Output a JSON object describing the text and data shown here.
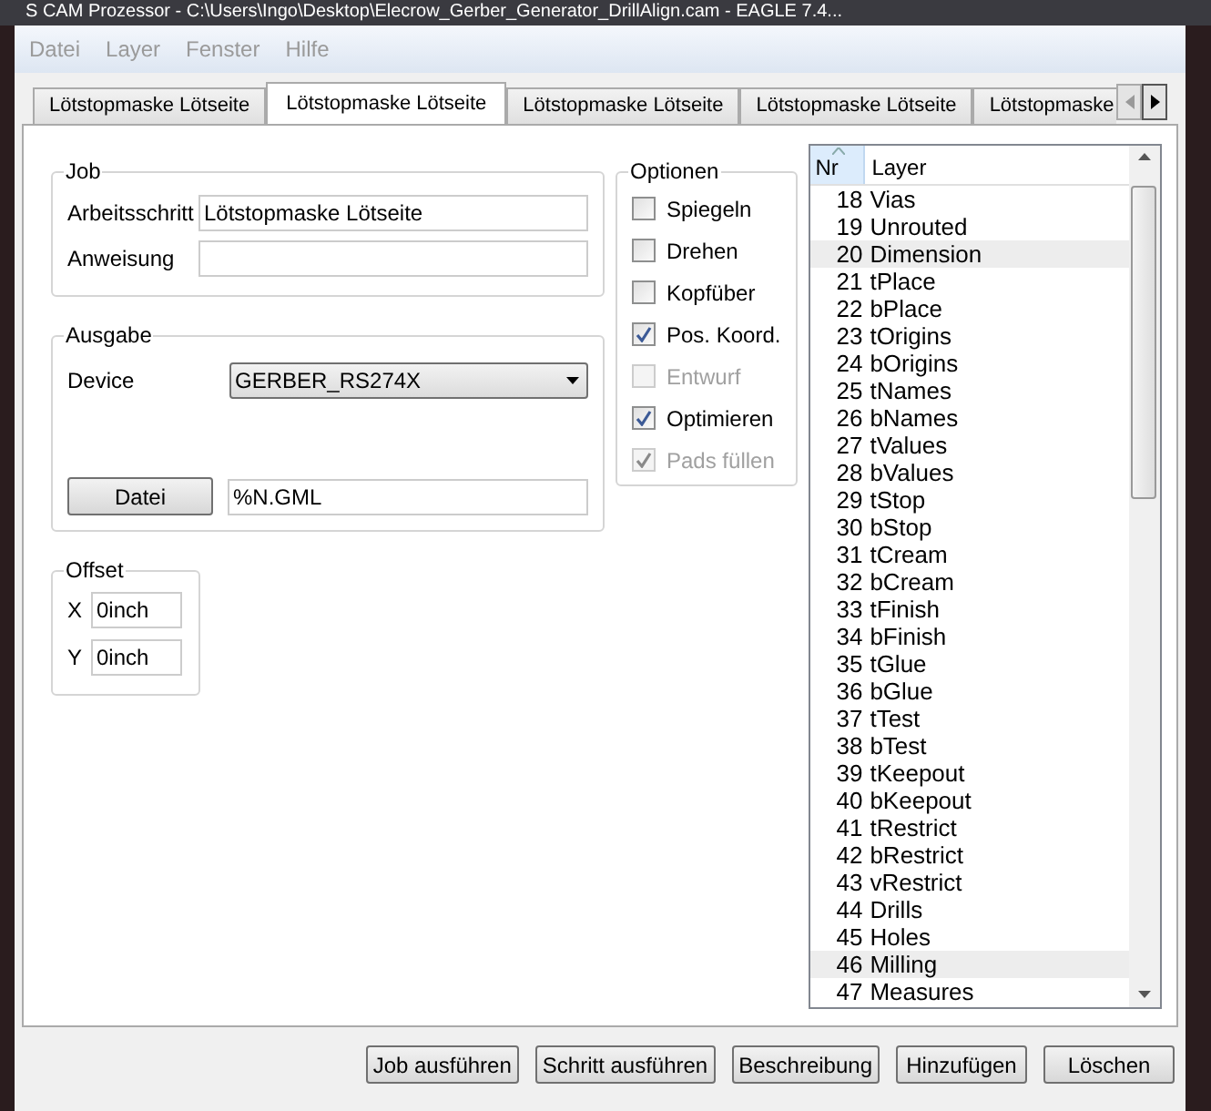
{
  "window": {
    "title": "S CAM Prozessor - C:\\Users\\Ingo\\Desktop\\Elecrow_Gerber_Generator_DrillAlign.cam - EAGLE 7.4..."
  },
  "menu": [
    {
      "label": "Datei",
      "disabled": true
    },
    {
      "label": "Layer",
      "disabled": true
    },
    {
      "label": "Fenster",
      "disabled": true
    },
    {
      "label": "Hilfe",
      "disabled": true
    }
  ],
  "tabs": [
    {
      "label": "Lötstopmaske Lötseite",
      "selected": false
    },
    {
      "label": "Lötstopmaske Lötseite",
      "selected": true
    },
    {
      "label": "Lötstopmaske Lötseite",
      "selected": false
    },
    {
      "label": "Lötstopmaske Lötseite",
      "selected": false
    },
    {
      "label": "Lötstopmaske",
      "selected": false
    }
  ],
  "job": {
    "title": "Job",
    "arbeitsschritt_label": "Arbeitsschritt",
    "arbeitsschritt_value": "Lötstopmaske Lötseite",
    "anweisung_label": "Anweisung"
  },
  "ausgabe": {
    "title": "Ausgabe",
    "device_label": "Device",
    "device_value": "GERBER_RS274X",
    "datei_button": "Datei",
    "datei_value": "%N.GML"
  },
  "offset": {
    "title": "Offset",
    "x_label": "X",
    "x_value": "0inch",
    "y_label": "Y",
    "y_value": "0inch"
  },
  "optionen": {
    "title": "Optionen",
    "items": [
      {
        "label": "Spiegeln",
        "checked": false,
        "disabled": false
      },
      {
        "label": "Drehen",
        "checked": false,
        "disabled": false
      },
      {
        "label": "Kopfüber",
        "checked": false,
        "disabled": false
      },
      {
        "label": "Pos. Koord.",
        "checked": true,
        "disabled": false
      },
      {
        "label": "Entwurf",
        "checked": false,
        "disabled": true
      },
      {
        "label": "Optimieren",
        "checked": true,
        "disabled": false
      },
      {
        "label": "Pads füllen",
        "checked": true,
        "disabled": true
      }
    ]
  },
  "layers": {
    "columns": [
      "Nr",
      "Layer"
    ],
    "rows": [
      {
        "nr": "18",
        "name": "Vias",
        "selected": false
      },
      {
        "nr": "19",
        "name": "Unrouted",
        "selected": false
      },
      {
        "nr": "20",
        "name": "Dimension",
        "selected": true
      },
      {
        "nr": "21",
        "name": "tPlace",
        "selected": false
      },
      {
        "nr": "22",
        "name": "bPlace",
        "selected": false
      },
      {
        "nr": "23",
        "name": "tOrigins",
        "selected": false
      },
      {
        "nr": "24",
        "name": "bOrigins",
        "selected": false
      },
      {
        "nr": "25",
        "name": "tNames",
        "selected": false
      },
      {
        "nr": "26",
        "name": "bNames",
        "selected": false
      },
      {
        "nr": "27",
        "name": "tValues",
        "selected": false
      },
      {
        "nr": "28",
        "name": "bValues",
        "selected": false
      },
      {
        "nr": "29",
        "name": "tStop",
        "selected": false
      },
      {
        "nr": "30",
        "name": "bStop",
        "selected": false
      },
      {
        "nr": "31",
        "name": "tCream",
        "selected": false
      },
      {
        "nr": "32",
        "name": "bCream",
        "selected": false
      },
      {
        "nr": "33",
        "name": "tFinish",
        "selected": false
      },
      {
        "nr": "34",
        "name": "bFinish",
        "selected": false
      },
      {
        "nr": "35",
        "name": "tGlue",
        "selected": false
      },
      {
        "nr": "36",
        "name": "bGlue",
        "selected": false
      },
      {
        "nr": "37",
        "name": "tTest",
        "selected": false
      },
      {
        "nr": "38",
        "name": "bTest",
        "selected": false
      },
      {
        "nr": "39",
        "name": "tKeepout",
        "selected": false
      },
      {
        "nr": "40",
        "name": "bKeepout",
        "selected": false
      },
      {
        "nr": "41",
        "name": "tRestrict",
        "selected": false
      },
      {
        "nr": "42",
        "name": "bRestrict",
        "selected": false
      },
      {
        "nr": "43",
        "name": "vRestrict",
        "selected": false
      },
      {
        "nr": "44",
        "name": "Drills",
        "selected": false
      },
      {
        "nr": "45",
        "name": "Holes",
        "selected": false
      },
      {
        "nr": "46",
        "name": "Milling",
        "selected": true
      },
      {
        "nr": "47",
        "name": "Measures",
        "selected": false
      }
    ]
  },
  "buttons": [
    "Job ausführen",
    "Schritt ausführen",
    "Beschreibung",
    "Hinzufügen",
    "Löschen"
  ]
}
